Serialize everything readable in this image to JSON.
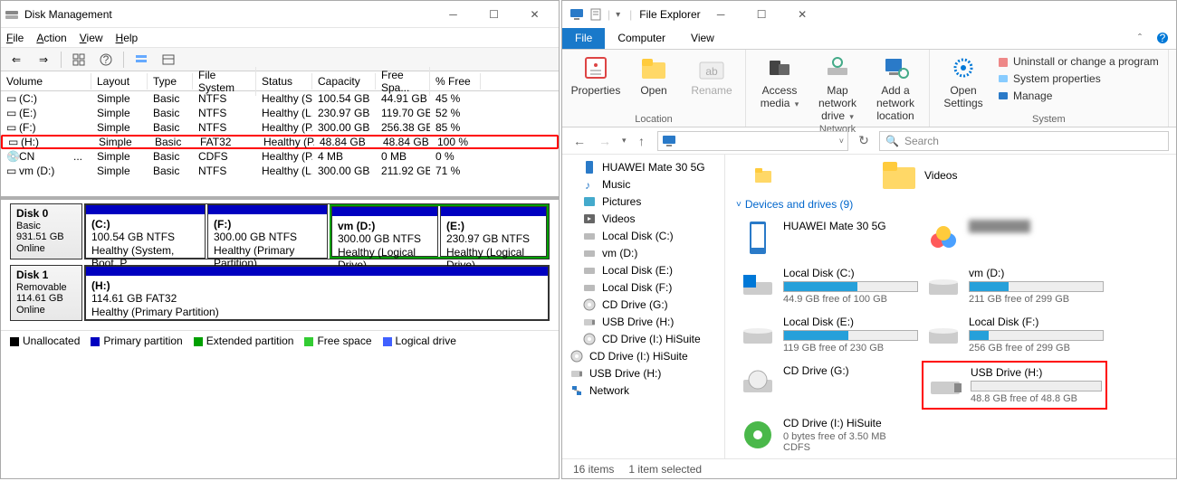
{
  "dm": {
    "title": "Disk Management",
    "menu": [
      "File",
      "Action",
      "View",
      "Help"
    ],
    "cols": [
      "Volume",
      "Layout",
      "Type",
      "File System",
      "Status",
      "Capacity",
      "Free Spa...",
      "% Free"
    ],
    "rows": [
      {
        "v": "(C:)",
        "l": "Simple",
        "t": "Basic",
        "fs": "NTFS",
        "s": "Healthy (S...",
        "c": "100.54 GB",
        "f": "44.91 GB",
        "p": "45 %"
      },
      {
        "v": "(E:)",
        "l": "Simple",
        "t": "Basic",
        "fs": "NTFS",
        "s": "Healthy (L...",
        "c": "230.97 GB",
        "f": "119.70 GB",
        "p": "52 %"
      },
      {
        "v": "(F:)",
        "l": "Simple",
        "t": "Basic",
        "fs": "NTFS",
        "s": "Healthy (P...",
        "c": "300.00 GB",
        "f": "256.38 GB",
        "p": "85 %"
      },
      {
        "v": "(H:)",
        "l": "Simple",
        "t": "Basic",
        "fs": "FAT32",
        "s": "Healthy (P...",
        "c": "48.84 GB",
        "f": "48.84 GB",
        "p": "100 %",
        "hl": true
      },
      {
        "v": "CN",
        "dots": "...",
        "l": "Simple",
        "t": "Basic",
        "fs": "CDFS",
        "s": "Healthy (P...",
        "c": "4 MB",
        "f": "0 MB",
        "p": "0 %"
      },
      {
        "v": "vm (D:)",
        "l": "Simple",
        "t": "Basic",
        "fs": "NTFS",
        "s": "Healthy (L...",
        "c": "300.00 GB",
        "f": "211.92 GB",
        "p": "71 %"
      }
    ],
    "disks": [
      {
        "name": "Disk 0",
        "sub1": "Basic",
        "sub2": "931.51 GB",
        "sub3": "Online",
        "parts": [
          {
            "bar": "blue",
            "l1": "(C:)",
            "l2": "100.54 GB NTFS",
            "l3": "Healthy (System, Boot, P"
          },
          {
            "bar": "blue",
            "l1": "(F:)",
            "l2": "300.00 GB NTFS",
            "l3": "Healthy (Primary Partition)"
          },
          {
            "bar": "blue",
            "green": true,
            "l1": "vm  (D:)",
            "l2": "300.00 GB NTFS",
            "l3": "Healthy (Logical Drive)"
          },
          {
            "bar": "blue",
            "green": true,
            "l1": "(E:)",
            "l2": "230.97 GB NTFS",
            "l3": "Healthy (Logical Drive)"
          }
        ]
      },
      {
        "name": "Disk 1",
        "sub1": "Removable",
        "sub2": "114.61 GB",
        "sub3": "Online",
        "parts": [
          {
            "bar": "blue",
            "wide": true,
            "l1": "(H:)",
            "l2": "114.61 GB FAT32",
            "l3": "Healthy (Primary Partition)"
          }
        ]
      }
    ],
    "legend": [
      {
        "c": "#000",
        "t": "Unallocated"
      },
      {
        "c": "#0000c0",
        "t": "Primary partition"
      },
      {
        "c": "#00a000",
        "t": "Extended partition"
      },
      {
        "c": "#33cc33",
        "t": "Free space"
      },
      {
        "c": "#4060ff",
        "t": "Logical drive"
      }
    ]
  },
  "fe": {
    "title": "File Explorer",
    "tabs": [
      "File",
      "Computer",
      "View"
    ],
    "ribbon": {
      "location": {
        "label": "Location",
        "btns": [
          {
            "n": "Properties",
            "ic": "props"
          },
          {
            "n": "Open",
            "ic": "folder"
          },
          {
            "n": "Rename",
            "ic": "rename",
            "dim": true
          }
        ]
      },
      "network": {
        "label": "Network",
        "btns": [
          {
            "n": "Access media",
            "ic": "media",
            "drop": true
          },
          {
            "n": "Map network drive",
            "ic": "mapdrive",
            "drop": true
          },
          {
            "n": "Add a network location",
            "ic": "addnet"
          }
        ]
      },
      "system": {
        "label": "System",
        "settings": "Open Settings",
        "links": [
          "Uninstall or change a program",
          "System properties",
          "Manage"
        ]
      }
    },
    "search_ph": "Search",
    "tree": [
      {
        "ic": "phone",
        "t": "HUAWEI Mate 30 5G"
      },
      {
        "ic": "music",
        "t": "Music"
      },
      {
        "ic": "pic",
        "t": "Pictures"
      },
      {
        "ic": "vid",
        "t": "Videos"
      },
      {
        "ic": "disk",
        "t": "Local Disk (C:)"
      },
      {
        "ic": "disk",
        "t": "vm (D:)"
      },
      {
        "ic": "disk",
        "t": "Local Disk (E:)"
      },
      {
        "ic": "disk",
        "t": "Local Disk (F:)"
      },
      {
        "ic": "cd",
        "t": "CD Drive (G:)"
      },
      {
        "ic": "usb",
        "t": "USB Drive (H:)"
      },
      {
        "ic": "cd",
        "t": "CD Drive (I:) HiSuite"
      },
      {
        "ic": "cd",
        "t": "CD Drive (I:) HiSuite",
        "indent": false
      },
      {
        "ic": "usb",
        "t": "USB Drive (H:)",
        "indent": false
      },
      {
        "ic": "net",
        "t": "Network",
        "indent": false
      }
    ],
    "section_folders": {
      "videos": "Videos"
    },
    "section_head": "Devices and drives (9)",
    "drives": [
      {
        "col": 1,
        "name": "HUAWEI Mate 30 5G",
        "ic": "phone",
        "nobar": true
      },
      {
        "col": 2,
        "name": "",
        "ic": "cloud",
        "nobar": true,
        "blur": true
      },
      {
        "col": 1,
        "name": "Local Disk (C:)",
        "sub": "44.9 GB free of 100 GB",
        "used": 55,
        "ic": "disk-win"
      },
      {
        "col": 2,
        "name": "vm (D:)",
        "sub": "211 GB free of 299 GB",
        "used": 29,
        "ic": "disk"
      },
      {
        "col": 1,
        "name": "Local Disk (E:)",
        "sub": "119 GB free of 230 GB",
        "used": 48,
        "ic": "disk"
      },
      {
        "col": 2,
        "name": "Local Disk (F:)",
        "sub": "256 GB free of 299 GB",
        "used": 14,
        "ic": "disk"
      },
      {
        "col": 1,
        "name": "CD Drive (G:)",
        "ic": "cd",
        "nobar": true
      },
      {
        "col": 2,
        "name": "USB Drive (H:)",
        "sub": "48.8 GB free of 48.8 GB",
        "used": 0,
        "ic": "usb",
        "red": true
      },
      {
        "col": 1,
        "name": "CD Drive (I:) HiSuite",
        "sub": "0 bytes free of 3.50 MB",
        "sub2": "CDFS",
        "ic": "cd-g",
        "nobar": true
      }
    ],
    "status": {
      "items": "16 items",
      "sel": "1 item selected"
    }
  }
}
